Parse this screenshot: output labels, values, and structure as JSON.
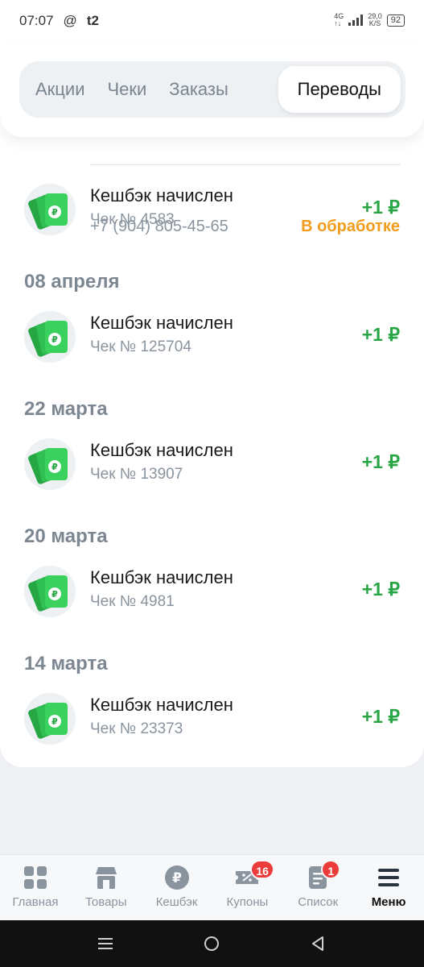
{
  "status_bar": {
    "time": "07:07",
    "at_sign": "@",
    "carrier": "t2",
    "network": "4G",
    "network_sub": "↑↓",
    "speed_value": "29,0",
    "speed_unit": "K/S",
    "battery": "92"
  },
  "tabs": [
    {
      "label": "Акции"
    },
    {
      "label": "Чеки"
    },
    {
      "label": "Заказы"
    },
    {
      "label": "Переводы"
    }
  ],
  "partial_row": {
    "phone": "+7 (904) 805-45-65",
    "status": "В обработке"
  },
  "groups": [
    {
      "date": "",
      "items": [
        {
          "title": "Кешбэк начислен",
          "sub": "Чек № 4583",
          "amount": "+1 ₽"
        }
      ]
    },
    {
      "date": "08 апреля",
      "items": [
        {
          "title": "Кешбэк начислен",
          "sub": "Чек № 125704",
          "amount": "+1 ₽"
        }
      ]
    },
    {
      "date": "22 марта",
      "items": [
        {
          "title": "Кешбэк начислен",
          "sub": "Чек № 13907",
          "amount": "+1 ₽"
        }
      ]
    },
    {
      "date": "20 марта",
      "items": [
        {
          "title": "Кешбэк начислен",
          "sub": "Чек № 4981",
          "amount": "+1 ₽"
        }
      ]
    },
    {
      "date": "14 марта",
      "items": [
        {
          "title": "Кешбэк начислен",
          "sub": "Чек № 23373",
          "amount": "+1 ₽"
        }
      ]
    }
  ],
  "bottom_nav": [
    {
      "label": "Главная",
      "icon": "grid-icon"
    },
    {
      "label": "Товары",
      "icon": "shop-icon"
    },
    {
      "label": "Кешбэк",
      "icon": "ruble-coin-icon"
    },
    {
      "label": "Купоны",
      "icon": "coupon-icon",
      "badge": "16"
    },
    {
      "label": "Список",
      "icon": "list-icon",
      "badge": "1"
    },
    {
      "label": "Меню",
      "icon": "hamburger-icon"
    }
  ],
  "colors": {
    "accent_green": "#28a645",
    "pending_orange": "#f29c1b",
    "badge_red": "#ec3b3b"
  }
}
